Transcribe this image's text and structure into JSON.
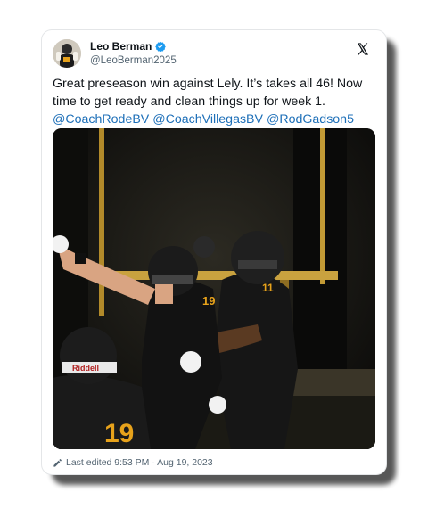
{
  "author": {
    "name": "Leo Berman",
    "handle": "@LeoBerman2025",
    "verified": true
  },
  "tweet": {
    "text": "Great preseason win against Lely. It’s takes all 46! Now time to get ready and clean things up for week 1.",
    "mentions": [
      "@CoachRodeBV",
      "@CoachVillegasBV",
      "@RodGadson5"
    ]
  },
  "photo": {
    "helmet_brand": "Riddell",
    "jersey_numbers": [
      "19",
      "11",
      "19"
    ]
  },
  "footer": {
    "edited_label": "Last edited 9:53 PM · Aug 19, 2023"
  },
  "colors": {
    "mention": "#1d6fb8",
    "verified_badge": "#1d9bf0",
    "jersey_gold": "#e7a21b"
  },
  "icons": {
    "platform": "x-logo-icon",
    "verified": "verified-badge-icon",
    "edit": "pencil-icon"
  }
}
